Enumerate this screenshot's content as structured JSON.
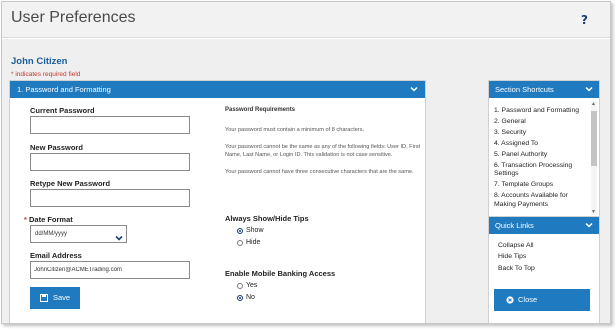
{
  "header": {
    "title": "User Preferences",
    "help_icon": "question-mark-icon"
  },
  "user": {
    "name": "John Citizen"
  },
  "required_note": "* indicates required field",
  "panel": {
    "title": "1. Password and Formatting",
    "fields": {
      "current_password": {
        "label": "Current Password",
        "value": ""
      },
      "new_password": {
        "label": "New Password",
        "value": ""
      },
      "retype_password": {
        "label": "Retype New Password",
        "value": ""
      },
      "date_format": {
        "required_mark": "*",
        "label": "Date Format",
        "value": "dd/MM/yyyy"
      },
      "email": {
        "label": "Email Address",
        "value": "JohnCitizen@ACMETrading.com"
      }
    },
    "save_label": "Save",
    "requirements": {
      "title": "Password Requirements",
      "lines": [
        "Your password must contain a minimum of 8 characters.",
        "Your password cannot be the same as any of the following fields: User ID, First Name, Last Name, or Login ID. This validation is not case sensitive.",
        "Your password cannot have three consecutive characters that are the same."
      ]
    },
    "tips": {
      "title": "Always Show/Hide Tips",
      "options": [
        "Show",
        "Hide"
      ],
      "selected": "Show"
    },
    "mobile": {
      "title": "Enable Mobile Banking Access",
      "options": [
        "Yes",
        "No"
      ],
      "selected": "No"
    }
  },
  "shortcuts": {
    "title": "Section Shortcuts",
    "items": [
      "1. Password and Formatting",
      "2. General",
      "3. Security",
      "4. Assigned To",
      "5. Panel Authority",
      "6. Transaction Processing Settings",
      "7. Template Groups",
      "8. Accounts Available for Making Payments"
    ]
  },
  "quick_links": {
    "title": "Quick Links",
    "items": [
      "Collapse All",
      "Hide Tips",
      "Back To Top"
    ],
    "close_label": "Close"
  },
  "colors": {
    "accent": "#1f7ac0",
    "title_blue": "#1a5d99",
    "required_red": "#c0392b"
  }
}
